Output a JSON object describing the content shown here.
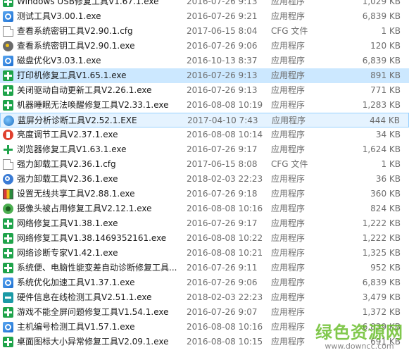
{
  "files": [
    {
      "name": "Windows USB修复工具V1.67.1.exe",
      "date": "2016-07-26 9:13",
      "type": "应用程序",
      "size": "1,029 KB",
      "icon": "usb-repair-icon"
    },
    {
      "name": "测试工具V3.00.1.exe",
      "date": "2016-07-26 9:21",
      "type": "应用程序",
      "size": "6,839 KB",
      "icon": "app-blue-icon"
    },
    {
      "name": "查看系统密钥工具V2.90.1.cfg",
      "date": "2017-06-15 8:04",
      "type": "CFG 文件",
      "size": "1 KB",
      "icon": "document-icon"
    },
    {
      "name": "查看系统密钥工具V2.90.1.exe",
      "date": "2016-07-26 9:06",
      "type": "应用程序",
      "size": "120 KB",
      "icon": "key-gear-icon"
    },
    {
      "name": "磁盘优化V3.03.1.exe",
      "date": "2016-10-13 8:37",
      "type": "应用程序",
      "size": "6,839 KB",
      "icon": "app-blue-icon"
    },
    {
      "name": "打印机修复工具V1.65.1.exe",
      "date": "2016-07-26 9:13",
      "type": "应用程序",
      "size": "891 KB",
      "icon": "repair-plus-icon"
    },
    {
      "name": "关闭驱动自动更新工具V2.26.1.exe",
      "date": "2016-07-26 9:13",
      "type": "应用程序",
      "size": "771 KB",
      "icon": "repair-plus-icon"
    },
    {
      "name": "机器睡眠无法唤醒修复工具V2.33.1.exe",
      "date": "2016-08-08 10:19",
      "type": "应用程序",
      "size": "1,283 KB",
      "icon": "repair-plus-icon"
    },
    {
      "name": "蓝屏分析诊断工具V2.52.1.EXE",
      "date": "2017-04-10 7:43",
      "type": "应用程序",
      "size": "444 KB",
      "icon": "globe-icon"
    },
    {
      "name": "亮度调节工具V2.37.1.exe",
      "date": "2016-08-08 10:14",
      "type": "应用程序",
      "size": "34 KB",
      "icon": "brightness-icon"
    },
    {
      "name": "浏览器修复工具V1.63.1.exe",
      "date": "2016-07-26 9:17",
      "type": "应用程序",
      "size": "1,624 KB",
      "icon": "green-plus-icon"
    },
    {
      "name": "强力卸载工具V2.36.1.cfg",
      "date": "2017-06-15 8:08",
      "type": "CFG 文件",
      "size": "1 KB",
      "icon": "document-icon"
    },
    {
      "name": "强力卸载工具V2.36.1.exe",
      "date": "2018-02-03 22:23",
      "type": "应用程序",
      "size": "36 KB",
      "icon": "uninstall-icon"
    },
    {
      "name": "设置无线共享工具V2.88.1.exe",
      "date": "2016-07-26 9:18",
      "type": "应用程序",
      "size": "360 KB",
      "icon": "wifi-share-icon"
    },
    {
      "name": "摄像头被占用修复工具V2.12.1.exe",
      "date": "2016-08-08 10:16",
      "type": "应用程序",
      "size": "824 KB",
      "icon": "camera-icon"
    },
    {
      "name": "网络修复工具V1.38.1.exe",
      "date": "2016-07-26 9:17",
      "type": "应用程序",
      "size": "1,222 KB",
      "icon": "repair-plus-icon"
    },
    {
      "name": "网络修复工具V1.38.1469352161.exe",
      "date": "2016-08-08 10:22",
      "type": "应用程序",
      "size": "1,222 KB",
      "icon": "repair-plus-icon"
    },
    {
      "name": "网络诊断专家V1.42.1.exe",
      "date": "2016-08-08 10:21",
      "type": "应用程序",
      "size": "1,325 KB",
      "icon": "repair-plus-icon"
    },
    {
      "name": "系统便、电脑性能变差自动诊断修复工具...",
      "date": "2016-07-26 9:11",
      "type": "应用程序",
      "size": "952 KB",
      "icon": "repair-plus-icon"
    },
    {
      "name": "系统优化加速工具V1.37.1.exe",
      "date": "2016-07-26 9:06",
      "type": "应用程序",
      "size": "6,839 KB",
      "icon": "app-blue-icon"
    },
    {
      "name": "硬件信息在线检测工具V2.51.1.exe",
      "date": "2018-02-03 22:23",
      "type": "应用程序",
      "size": "3,479 KB",
      "icon": "hardware-icon"
    },
    {
      "name": "游戏不能全屏问题修复工具V1.54.1.exe",
      "date": "2016-07-26 9:07",
      "type": "应用程序",
      "size": "1,372 KB",
      "icon": "repair-plus-icon"
    },
    {
      "name": "主机编号检测工具V1.57.1.exe",
      "date": "2016-08-08 10:16",
      "type": "应用程序",
      "size": "6,839 KB",
      "icon": "app-blue-icon"
    },
    {
      "name": "桌面图标大小异常修复工具V2.09.1.exe",
      "date": "2016-08-08 10:15",
      "type": "应用程序",
      "size": "691 KB",
      "icon": "repair-plus-icon"
    }
  ],
  "selected_index": 5,
  "hover_index": 8,
  "watermark": {
    "cn": "绿色资源网",
    "en": "www.downcc.com"
  }
}
